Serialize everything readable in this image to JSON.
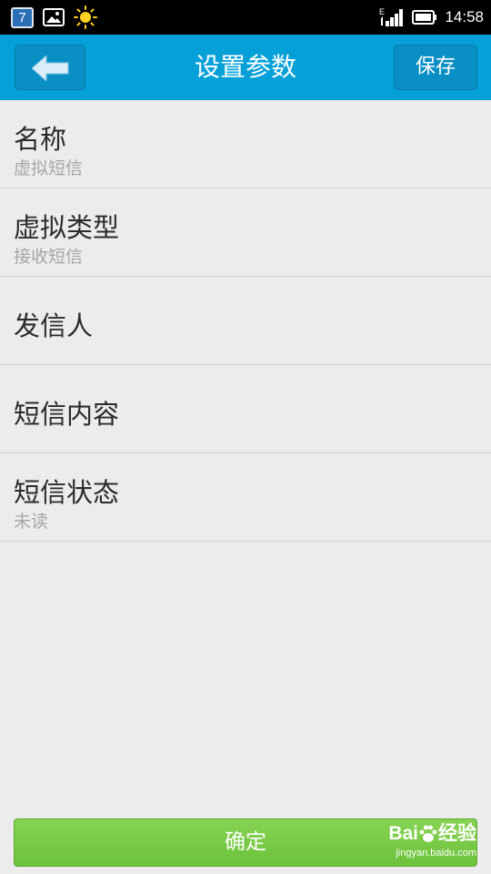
{
  "status_bar": {
    "calendar_day": "7",
    "time": "14:58",
    "network_type": "E",
    "icons": [
      "calendar-icon",
      "gallery-icon",
      "weather-sun-icon",
      "signal-icon",
      "battery-icon"
    ]
  },
  "header": {
    "title": "设置参数",
    "save_label": "保存",
    "back_icon": "arrow-left-icon"
  },
  "settings": {
    "items": [
      {
        "label": "名称",
        "value": "虚拟短信"
      },
      {
        "label": "虚拟类型",
        "value": "接收短信"
      },
      {
        "label": "发信人",
        "value": ""
      },
      {
        "label": "短信内容",
        "value": ""
      },
      {
        "label": "短信状态",
        "value": "未读"
      }
    ]
  },
  "footer": {
    "confirm_label": "确定"
  },
  "watermark": {
    "logo_prefix": "Bai",
    "logo_suffix": "经验",
    "url": "jingyan.baidu.com"
  },
  "colors": {
    "header": "#06a0d9",
    "confirm": "#78c944",
    "background": "#ececec"
  }
}
